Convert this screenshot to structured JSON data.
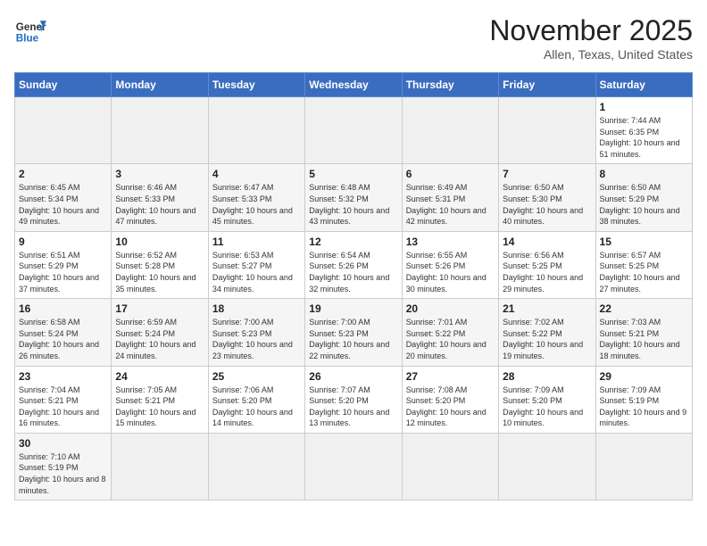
{
  "header": {
    "logo_general": "General",
    "logo_blue": "Blue",
    "month": "November 2025",
    "location": "Allen, Texas, United States"
  },
  "weekdays": [
    "Sunday",
    "Monday",
    "Tuesday",
    "Wednesday",
    "Thursday",
    "Friday",
    "Saturday"
  ],
  "days": [
    {
      "num": "",
      "info": ""
    },
    {
      "num": "",
      "info": ""
    },
    {
      "num": "",
      "info": ""
    },
    {
      "num": "",
      "info": ""
    },
    {
      "num": "",
      "info": ""
    },
    {
      "num": "",
      "info": ""
    },
    {
      "num": "1",
      "info": "Sunrise: 7:44 AM\nSunset: 6:35 PM\nDaylight: 10 hours and 51 minutes."
    },
    {
      "num": "2",
      "info": "Sunrise: 6:45 AM\nSunset: 5:34 PM\nDaylight: 10 hours and 49 minutes."
    },
    {
      "num": "3",
      "info": "Sunrise: 6:46 AM\nSunset: 5:33 PM\nDaylight: 10 hours and 47 minutes."
    },
    {
      "num": "4",
      "info": "Sunrise: 6:47 AM\nSunset: 5:33 PM\nDaylight: 10 hours and 45 minutes."
    },
    {
      "num": "5",
      "info": "Sunrise: 6:48 AM\nSunset: 5:32 PM\nDaylight: 10 hours and 43 minutes."
    },
    {
      "num": "6",
      "info": "Sunrise: 6:49 AM\nSunset: 5:31 PM\nDaylight: 10 hours and 42 minutes."
    },
    {
      "num": "7",
      "info": "Sunrise: 6:50 AM\nSunset: 5:30 PM\nDaylight: 10 hours and 40 minutes."
    },
    {
      "num": "8",
      "info": "Sunrise: 6:50 AM\nSunset: 5:29 PM\nDaylight: 10 hours and 38 minutes."
    },
    {
      "num": "9",
      "info": "Sunrise: 6:51 AM\nSunset: 5:29 PM\nDaylight: 10 hours and 37 minutes."
    },
    {
      "num": "10",
      "info": "Sunrise: 6:52 AM\nSunset: 5:28 PM\nDaylight: 10 hours and 35 minutes."
    },
    {
      "num": "11",
      "info": "Sunrise: 6:53 AM\nSunset: 5:27 PM\nDaylight: 10 hours and 34 minutes."
    },
    {
      "num": "12",
      "info": "Sunrise: 6:54 AM\nSunset: 5:26 PM\nDaylight: 10 hours and 32 minutes."
    },
    {
      "num": "13",
      "info": "Sunrise: 6:55 AM\nSunset: 5:26 PM\nDaylight: 10 hours and 30 minutes."
    },
    {
      "num": "14",
      "info": "Sunrise: 6:56 AM\nSunset: 5:25 PM\nDaylight: 10 hours and 29 minutes."
    },
    {
      "num": "15",
      "info": "Sunrise: 6:57 AM\nSunset: 5:25 PM\nDaylight: 10 hours and 27 minutes."
    },
    {
      "num": "16",
      "info": "Sunrise: 6:58 AM\nSunset: 5:24 PM\nDaylight: 10 hours and 26 minutes."
    },
    {
      "num": "17",
      "info": "Sunrise: 6:59 AM\nSunset: 5:24 PM\nDaylight: 10 hours and 24 minutes."
    },
    {
      "num": "18",
      "info": "Sunrise: 7:00 AM\nSunset: 5:23 PM\nDaylight: 10 hours and 23 minutes."
    },
    {
      "num": "19",
      "info": "Sunrise: 7:00 AM\nSunset: 5:23 PM\nDaylight: 10 hours and 22 minutes."
    },
    {
      "num": "20",
      "info": "Sunrise: 7:01 AM\nSunset: 5:22 PM\nDaylight: 10 hours and 20 minutes."
    },
    {
      "num": "21",
      "info": "Sunrise: 7:02 AM\nSunset: 5:22 PM\nDaylight: 10 hours and 19 minutes."
    },
    {
      "num": "22",
      "info": "Sunrise: 7:03 AM\nSunset: 5:21 PM\nDaylight: 10 hours and 18 minutes."
    },
    {
      "num": "23",
      "info": "Sunrise: 7:04 AM\nSunset: 5:21 PM\nDaylight: 10 hours and 16 minutes."
    },
    {
      "num": "24",
      "info": "Sunrise: 7:05 AM\nSunset: 5:21 PM\nDaylight: 10 hours and 15 minutes."
    },
    {
      "num": "25",
      "info": "Sunrise: 7:06 AM\nSunset: 5:20 PM\nDaylight: 10 hours and 14 minutes."
    },
    {
      "num": "26",
      "info": "Sunrise: 7:07 AM\nSunset: 5:20 PM\nDaylight: 10 hours and 13 minutes."
    },
    {
      "num": "27",
      "info": "Sunrise: 7:08 AM\nSunset: 5:20 PM\nDaylight: 10 hours and 12 minutes."
    },
    {
      "num": "28",
      "info": "Sunrise: 7:09 AM\nSunset: 5:20 PM\nDaylight: 10 hours and 10 minutes."
    },
    {
      "num": "29",
      "info": "Sunrise: 7:09 AM\nSunset: 5:19 PM\nDaylight: 10 hours and 9 minutes."
    },
    {
      "num": "30",
      "info": "Sunrise: 7:10 AM\nSunset: 5:19 PM\nDaylight: 10 hours and 8 minutes."
    },
    {
      "num": "",
      "info": ""
    },
    {
      "num": "",
      "info": ""
    },
    {
      "num": "",
      "info": ""
    },
    {
      "num": "",
      "info": ""
    },
    {
      "num": "",
      "info": ""
    },
    {
      "num": "",
      "info": ""
    }
  ]
}
